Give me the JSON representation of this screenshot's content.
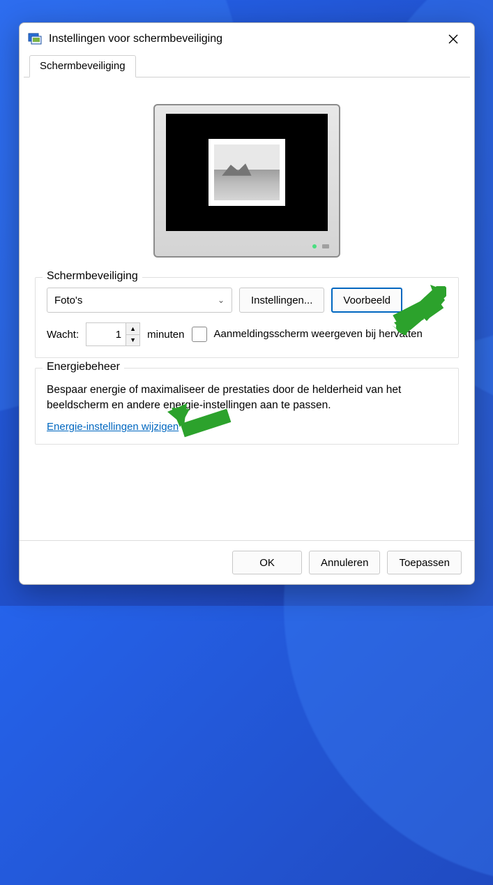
{
  "window": {
    "title": "Instellingen voor schermbeveiliging"
  },
  "tabs": {
    "screensaver": "Schermbeveiliging"
  },
  "screensaver": {
    "group_title": "Schermbeveiliging",
    "selected": "Foto's",
    "settings_btn": "Instellingen...",
    "preview_btn": "Voorbeeld",
    "wait_label": "Wacht:",
    "wait_value": "1",
    "wait_unit": "minuten",
    "resume_label": "Aanmeldingsscherm weergeven bij hervatten",
    "resume_checked": false
  },
  "power": {
    "group_title": "Energiebeheer",
    "desc": "Bespaar energie of maximaliseer de prestaties door de helderheid van het beeldscherm en andere energie-instellingen aan te passen.",
    "link": "Energie-instellingen wijzigen"
  },
  "buttons": {
    "ok": "OK",
    "cancel": "Annuleren",
    "apply": "Toepassen"
  },
  "annotations": {
    "arrow_color": "#2ca22c"
  }
}
